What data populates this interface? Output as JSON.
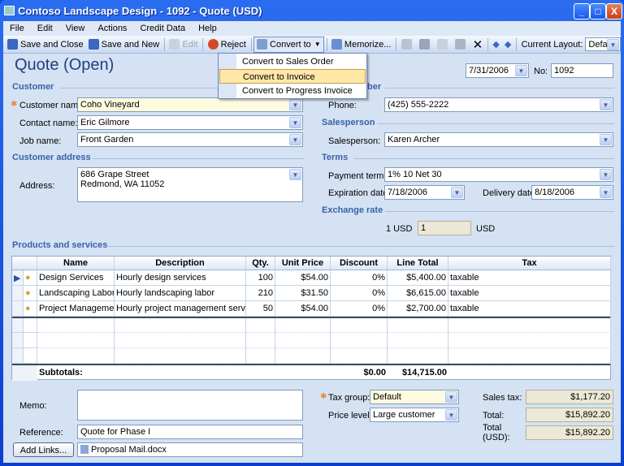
{
  "window": {
    "title": "Contoso Landscape Design - 1092 - Quote (USD)",
    "controls": [
      "_",
      "□",
      "X"
    ]
  },
  "menubar": [
    "File",
    "Edit",
    "View",
    "Actions",
    "Credit Data",
    "Help"
  ],
  "toolbar": {
    "save_close": "Save and Close",
    "save_new": "Save and New",
    "edit": "Edit",
    "reject": "Reject",
    "convert": "Convert to",
    "memorize": "Memorize...",
    "layout_label": "Current Layout:",
    "layout_value": "Default"
  },
  "convert_menu": [
    "Convert to Sales Order",
    "Convert to Invoice",
    "Convert to Progress Invoice"
  ],
  "form": {
    "title": "Quote (Open)",
    "date": "7/31/2006",
    "no_label": "No:",
    "no": "1092"
  },
  "customer": {
    "header": "Customer",
    "name_label": "Customer name:",
    "name": "Coho Vineyard",
    "contact_label": "Contact name:",
    "contact": "Eric Gilmore",
    "job_label": "Job name:",
    "job": "Front Garden"
  },
  "address": {
    "header": "Customer address",
    "label": "Address:",
    "line1": "686 Grape Street",
    "line2": "Redmond, WA 11052"
  },
  "right": {
    "header_fragment": "ber",
    "phone_label": "Phone:",
    "phone": "(425) 555-2222",
    "sales_header": "Salesperson",
    "sales_label": "Salesperson:",
    "sales": "Karen Archer",
    "terms_header": "Terms",
    "payment_label": "Payment terms:",
    "payment": "1% 10 Net 30",
    "exp_label": "Expiration date:",
    "exp": "7/18/2006",
    "deliv_label": "Delivery date:",
    "deliv": "8/18/2006",
    "exch_header": "Exchange rate",
    "exch_left": "1 USD  =",
    "exch_value": "1",
    "exch_right": "USD"
  },
  "products": {
    "header": "Products and services",
    "columns": [
      "Name",
      "Description",
      "Qty.",
      "Unit Price",
      "Discount",
      "Line Total",
      "Tax"
    ],
    "rows": [
      [
        "Design Services",
        "Hourly design services",
        "100",
        "$54.00",
        "0%",
        "$5,400.00",
        "taxable"
      ],
      [
        "Landscaping Labor",
        "Hourly landscaping labor",
        "210",
        "$31.50",
        "0%",
        "$6,615.00",
        "taxable"
      ],
      [
        "Project Management",
        "Hourly project management services",
        "50",
        "$54.00",
        "0%",
        "$2,700.00",
        "taxable"
      ]
    ],
    "subtotal_label": "Subtotals:",
    "subtotal_discount": "$0.00",
    "subtotal_total": "$14,715.00"
  },
  "bottom": {
    "memo_label": "Memo:",
    "memo": "",
    "ref_label": "Reference:",
    "ref": "Quote for Phase I",
    "add_links": "Add Links...",
    "attachment": "Proposal Mail.docx",
    "taxgroup_label": "Tax group:",
    "taxgroup": "Default",
    "price_label": "Price level:",
    "price": "Large customer",
    "salestax_label": "Sales tax:",
    "salestax": "$1,177.20",
    "total_label": "Total:",
    "total": "$15,892.20",
    "totalusd_label1": "Total",
    "totalusd_label2": "(USD):",
    "totalusd": "$15,892.20"
  }
}
